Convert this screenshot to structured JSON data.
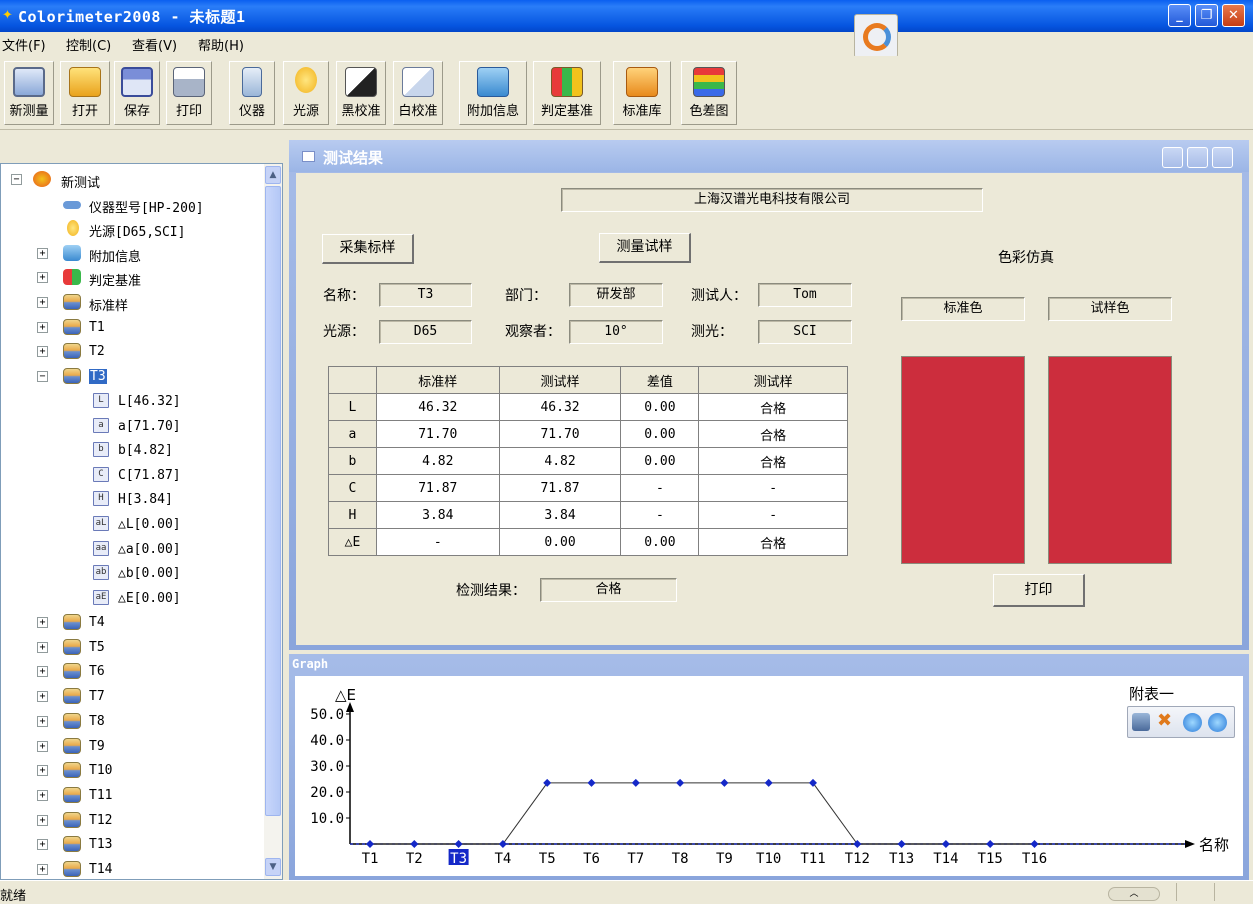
{
  "window": {
    "title": "Colorimeter2008 - 未标题1"
  },
  "menu": [
    "文件(F)",
    "控制(C)",
    "查看(V)",
    "帮助(H)"
  ],
  "toolbar": [
    "新测量",
    "打开",
    "保存",
    "打印",
    "仪器",
    "光源",
    "黑校准",
    "白校准",
    "附加信息",
    "判定基准",
    "标准库",
    "色差图"
  ],
  "tree": {
    "root": "新测试",
    "instrument": "仪器型号[HP-200]",
    "illuminant": "光源[D65,SCI]",
    "extra": "附加信息",
    "criteria": "判定基准",
    "standard": "标准样",
    "t1": "T1",
    "t2": "T2",
    "t3": "T3",
    "t3_children": [
      "L[46.32]",
      "a[71.70]",
      "b[4.82]",
      "C[71.87]",
      "H[3.84]",
      "△L[0.00]",
      "△a[0.00]",
      "△b[0.00]",
      "△E[0.00]"
    ],
    "t3_icons": [
      "L",
      "a",
      "b",
      "C",
      "H",
      "aL",
      "aa",
      "ab",
      "aE"
    ],
    "rest": [
      "T4",
      "T5",
      "T6",
      "T7",
      "T8",
      "T9",
      "T10",
      "T11",
      "T12",
      "T13",
      "T14"
    ]
  },
  "result": {
    "title": "测试结果",
    "company": "上海汉谱光电科技有限公司",
    "collect_btn": "采集标样",
    "measure_btn": "测量试样",
    "color_sim": "色彩仿真",
    "name_label": "名称：",
    "name_value": "T3",
    "dept_label": "部门：",
    "dept_value": "研发部",
    "tester_label": "测试人：",
    "tester_value": "Tom",
    "light_label": "光源：",
    "light_value": "D65",
    "observer_label": "观察者：",
    "observer_value": "10°",
    "measure_light_label": "测光：",
    "measure_light_value": "SCI",
    "std_color": "标准色",
    "sample_color": "试样色",
    "table_headers": [
      "",
      "标准样",
      "测试样",
      "差值",
      "测试样"
    ],
    "table_rows": [
      [
        "L",
        "46.32",
        "46.32",
        "0.00",
        "合格"
      ],
      [
        "a",
        "71.70",
        "71.70",
        "0.00",
        "合格"
      ],
      [
        "b",
        "4.82",
        "4.82",
        "0.00",
        "合格"
      ],
      [
        "C",
        "71.87",
        "71.87",
        "-",
        "-"
      ],
      [
        "H",
        "3.84",
        "3.84",
        "-",
        "-"
      ],
      [
        "△E",
        "-",
        "0.00",
        "0.00",
        "合格"
      ]
    ],
    "result_label": "检测结果：",
    "result_value": "合格",
    "print_btn": "打印",
    "swatch_color": "#cc2d3d"
  },
  "graph": {
    "title": "Graph",
    "table_label": "附表一",
    "ylabel": "△E",
    "xlabel": "名称",
    "yticks": [
      "50.0",
      "40.0",
      "30.0",
      "20.0",
      "10.0"
    ],
    "selected": "T3",
    "line_color": "#1428c8"
  },
  "chart_data": {
    "type": "line",
    "categories": [
      "T1",
      "T2",
      "T3",
      "T4",
      "T5",
      "T6",
      "T7",
      "T8",
      "T9",
      "T10",
      "T11",
      "T12",
      "T13",
      "T14",
      "T15",
      "T16"
    ],
    "values": [
      0,
      0,
      0,
      0,
      23.5,
      23.5,
      23.5,
      23.5,
      23.5,
      23.5,
      23.5,
      0,
      0,
      0,
      0,
      0
    ],
    "ylim": [
      0,
      50
    ],
    "xlabel": "名称",
    "ylabel": "△E"
  },
  "status": {
    "text": "就绪"
  }
}
